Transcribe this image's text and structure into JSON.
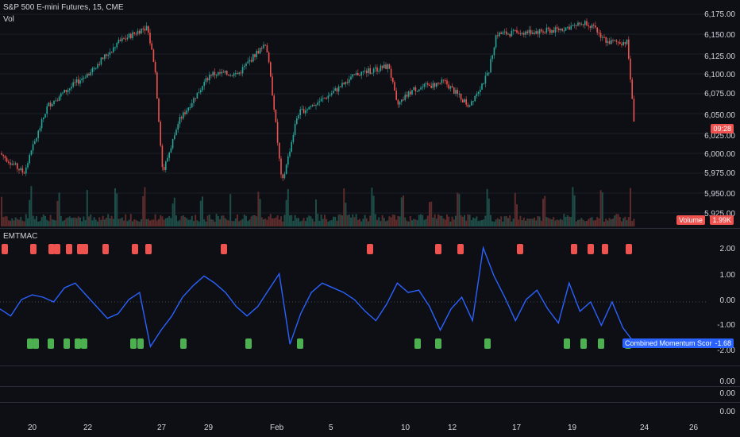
{
  "header": {
    "symbol": "S&P 500 E-mini Futures, 15, CME",
    "volume_label": "Vol"
  },
  "price_axis": [
    "6,175.00",
    "6,150.00",
    "6,125.00",
    "6,100.00",
    "6,075.00",
    "6,050.00",
    "6,025.00",
    "6,000.00",
    "5,975.00",
    "5,950.00",
    "5,925.00"
  ],
  "price_tag": {
    "time": "09:28"
  },
  "volume_tag": {
    "label": "Volume",
    "value": "1.99K"
  },
  "indicator": {
    "name": "EMTMAC",
    "axis": [
      "2.00",
      "1.00",
      "0.00",
      "-1.00",
      "-2.00"
    ],
    "score_label": "Combined Momentum Score",
    "score_value": "-1.68"
  },
  "lower_axis": [
    "0.00",
    "0.00",
    "0.00"
  ],
  "time_axis": [
    "20",
    "22",
    "27",
    "29",
    "Feb",
    "5",
    "10",
    "12",
    "17",
    "19",
    "24",
    "26"
  ],
  "colors": {
    "up": "#26a69a",
    "down": "#ef5350",
    "line": "#2962ff",
    "bg": "#0e0f14"
  },
  "chart_data": {
    "type": "line",
    "title": "S&P 500 E-mini Futures, 15, CME",
    "series": [
      {
        "name": "EMTMAC",
        "values": [
          -0.3,
          -0.6,
          0.1,
          0.3,
          0.2,
          0.0,
          0.6,
          0.8,
          0.3,
          -0.2,
          -0.7,
          -0.5,
          0.1,
          0.4,
          -1.9,
          -1.2,
          -0.6,
          0.2,
          0.7,
          1.1,
          0.8,
          0.4,
          -0.2,
          -0.6,
          -0.2,
          0.5,
          1.2,
          -1.8,
          -0.5,
          0.4,
          0.8,
          0.6,
          0.4,
          0.1,
          -0.4,
          -0.8,
          -0.1,
          0.8,
          0.4,
          0.5,
          -0.2,
          -1.2,
          -0.3,
          0.2,
          -0.8,
          2.3,
          1.1,
          0.2,
          -0.8,
          0.1,
          0.5,
          -0.3,
          -0.9,
          0.8,
          -0.4,
          0.0,
          -1.0,
          0.0,
          -1.1,
          -1.7
        ]
      }
    ],
    "ylim": [
      -2.3,
      2.5
    ]
  }
}
